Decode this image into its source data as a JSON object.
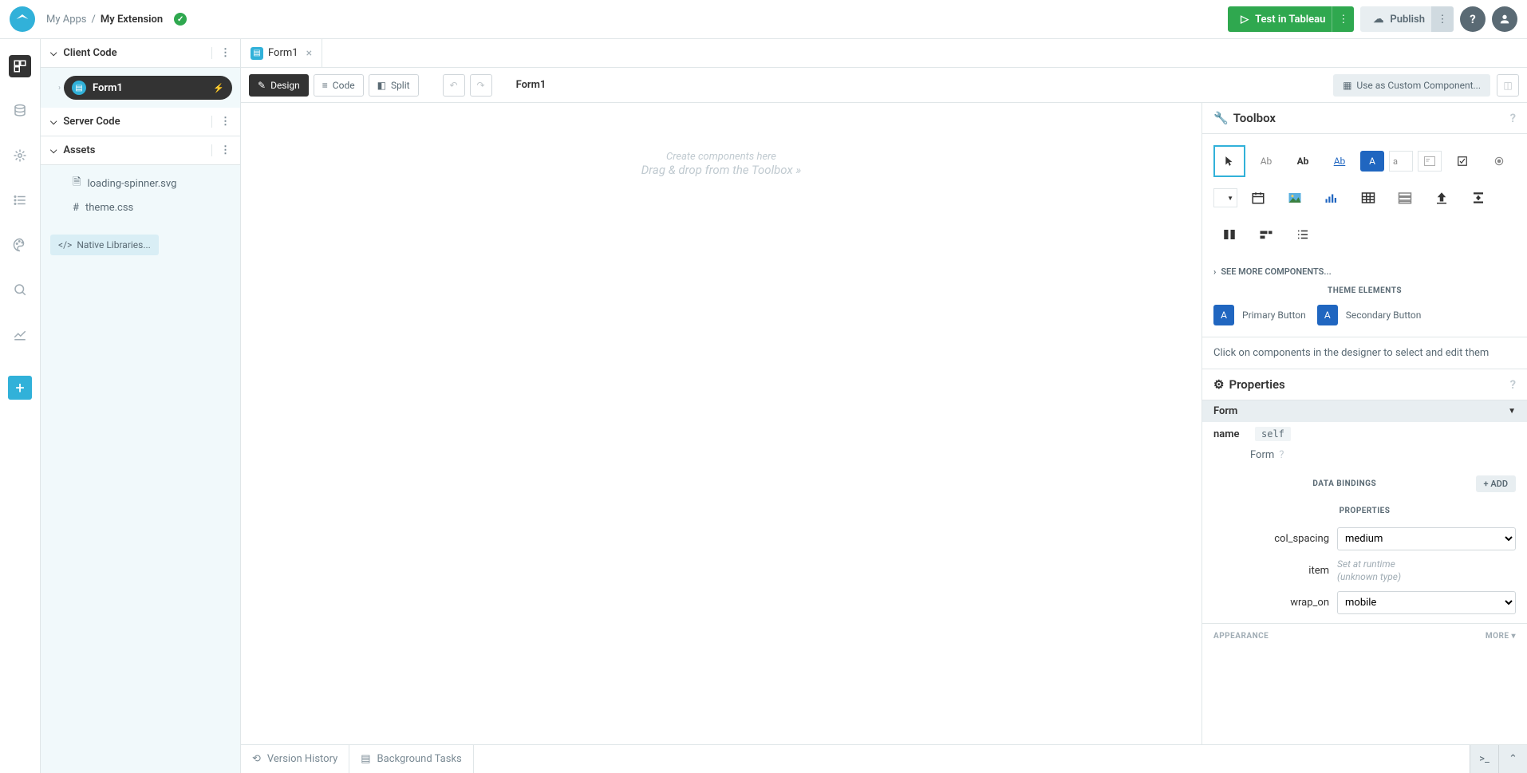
{
  "breadcrumb": {
    "parent": "My Apps",
    "separator": "/",
    "current": "My Extension"
  },
  "topbar": {
    "test_label": "Test in Tableau",
    "publish_label": "Publish"
  },
  "side": {
    "client_code": "Client Code",
    "server_code": "Server Code",
    "assets": "Assets",
    "form1": "Form1",
    "asset1": "loading-spinner.svg",
    "asset2": "theme.css",
    "native_libs": "Native Libraries..."
  },
  "tabs": {
    "form1": "Form1"
  },
  "toolbar": {
    "design": "Design",
    "code": "Code",
    "split": "Split",
    "title": "Form1",
    "custom": "Use as Custom Component..."
  },
  "canvas": {
    "line1": "Create components here",
    "line2": "Drag & drop from the Toolbox"
  },
  "toolbox": {
    "header": "Toolbox",
    "see_more": "SEE MORE COMPONENTS...",
    "theme_header": "THEME ELEMENTS",
    "primary_btn": "Primary Button",
    "secondary_btn": "Secondary Button",
    "info": "Click on components in the designer to select and edit them",
    "tool_label_Ab1": "Ab",
    "tool_label_Ab2": "Ab",
    "tool_label_Ab3": "Ab",
    "tool_btn_A": "A",
    "tool_input_a": "a",
    "theme_box_A": "A"
  },
  "props": {
    "header": "Properties",
    "type": "Form",
    "name_label": "name",
    "name_value": "self",
    "form_label": "Form",
    "data_bindings": "DATA BINDINGS",
    "add": "+ ADD",
    "properties_section": "PROPERTIES",
    "col_spacing_label": "col_spacing",
    "col_spacing_value": "medium",
    "item_label": "item",
    "item_value_l1": "Set at runtime",
    "item_value_l2": "(unknown type)",
    "wrap_on_label": "wrap_on",
    "wrap_on_value": "mobile",
    "appearance": "APPEARANCE",
    "more": "MORE ▾"
  },
  "bottom": {
    "version_history": "Version History",
    "background_tasks": "Background Tasks"
  }
}
